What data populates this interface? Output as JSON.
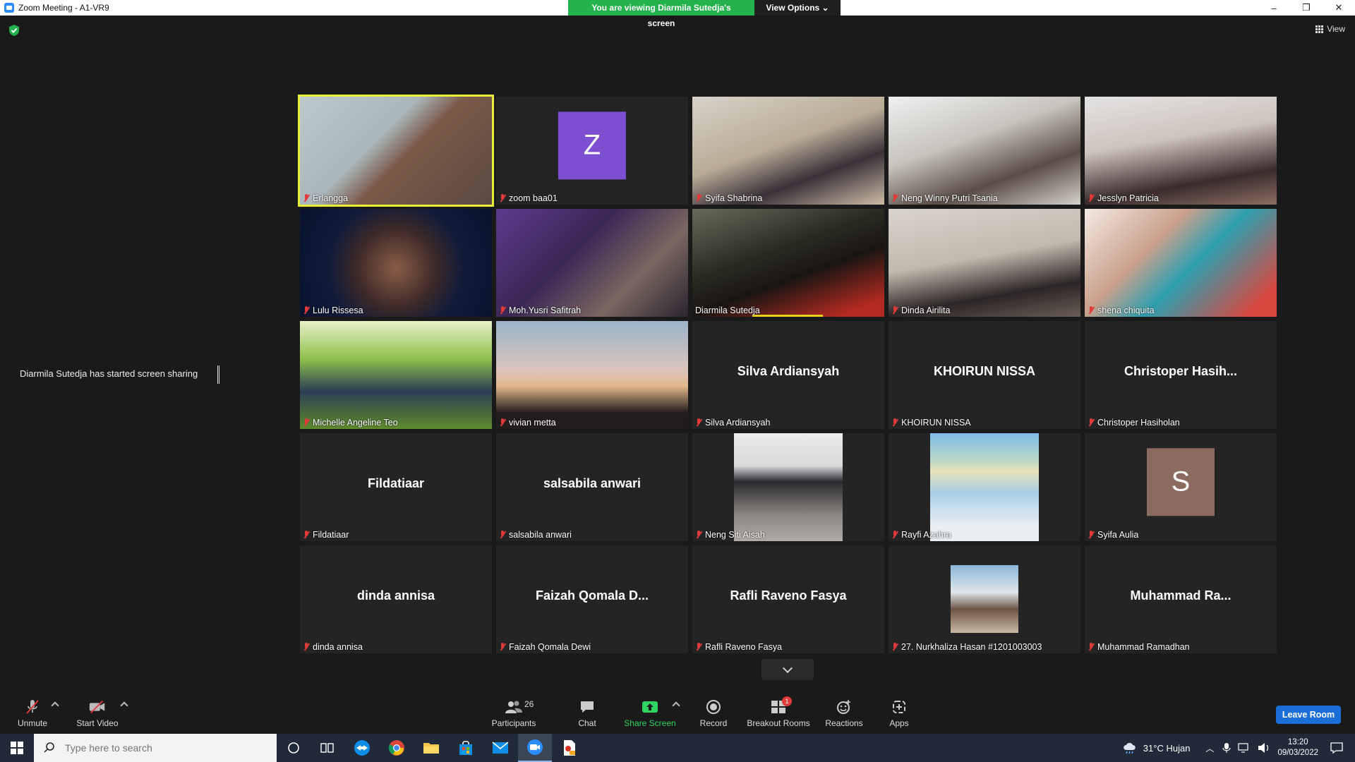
{
  "window": {
    "title": "Zoom Meeting - A1-VR9",
    "controls": [
      "–",
      "❐",
      "✕"
    ]
  },
  "banner": {
    "viewing": "You are viewing Diarmila Sutedja's screen",
    "view_options": "View Options ⌄"
  },
  "view_button": "View",
  "notice": "Diarmila Sutedja has started screen sharing",
  "tiles": [
    {
      "name": "Erlangga",
      "type": "video",
      "active": true,
      "bg": "linear-gradient(135deg,#bcc9cf 0%,#a9b6bb 40%,#7b5a48 55%,#5a4a42 100%)"
    },
    {
      "name": "zoom baa01",
      "type": "letter",
      "letter": "Z",
      "color": "#7b4fcf"
    },
    {
      "name": "Syifa Shabrina",
      "type": "video",
      "bg": "linear-gradient(160deg,#d8d2c8 0%,#b9ab97 45%,#3a3138 70%,#cdbba6 100%)"
    },
    {
      "name": "Neng Winny Putri Tsania",
      "type": "video",
      "bg": "linear-gradient(160deg,#eef0f0 0%,#c7c3bd 40%,#5b4c46 70%,#d6d2cc 100%)"
    },
    {
      "name": "Jesslyn Patricia",
      "type": "video",
      "bg": "linear-gradient(170deg,#e3e3e3 0%,#cfc3bd 40%,#3a2c2c 75%,#8b6f63 100%)"
    },
    {
      "name": "Lulu Rissesa",
      "type": "video",
      "bg": "radial-gradient(circle at 50% 55%,#8a5d47 0%,#3d2a28 35%,#101b3a 60%,#08122e 100%)"
    },
    {
      "name": "Moh.Yusri Safitrah",
      "type": "video",
      "bg": "linear-gradient(135deg,#5e3a8e 0%,#3b2755 40%,#7a6760 70%,#2b2430 100%)"
    },
    {
      "name": "Diarmila Sutedja",
      "type": "video",
      "speaking": true,
      "bg": "linear-gradient(160deg,#6a6a5a 0%,#2a2a22 40%,#1a1512 60%,#b22a20 90%)"
    },
    {
      "name": "Dinda Airilita",
      "type": "video",
      "bg": "linear-gradient(170deg,#d9d4cc 0%,#c3b9ad 45%,#2c2526 75%,#6a5d55 100%)"
    },
    {
      "name": "shena chiquita",
      "type": "video",
      "bg": "linear-gradient(135deg,#f3e9e2 0%,#c9a08b 35%,#2f9fb0 55%,#d8483e 90%)"
    },
    {
      "name": "Michelle Angeline Teo",
      "type": "video",
      "bg": "linear-gradient(180deg,#e8f1c8 0%,#8fc04d 35%,#2c3e56 65%,#5e8a2c 100%)"
    },
    {
      "name": "vivian metta",
      "type": "video",
      "bg": "linear-gradient(180deg,#9bb5c9 0%,#d9c4bc 45%,#e4b98b 60%,#231c1c 85%)"
    },
    {
      "name": "Silva Ardiansyah",
      "type": "name",
      "display": "Silva Ardiansyah"
    },
    {
      "name": "KHOIRUN NISSA",
      "type": "name",
      "display": "KHOIRUN NISSA"
    },
    {
      "name": "Christoper Hasiholan",
      "type": "name",
      "display": "Christoper  Hasih..."
    },
    {
      "name": "Fildatiaar",
      "type": "name",
      "display": "Fildatiaar"
    },
    {
      "name": "salsabila anwari",
      "type": "name",
      "display": "salsabila anwari"
    },
    {
      "name": "Neng Siti Aisah",
      "type": "pic",
      "bg": "linear-gradient(180deg,#e9eaec 0%,#d8dadc 30%,#2a2a2e 45%,#8a8580 75%,#b1aca6 100%)"
    },
    {
      "name": "Rayfi Azahra",
      "type": "pic",
      "bg": "linear-gradient(180deg,#7fbce6 0%,#b9d7c9 25%,#e8e3b7 35%,#a7cde6 55%,#e8eef2 85%)"
    },
    {
      "name": "Syifa Aulia",
      "type": "letter",
      "letter": "S",
      "color": "#8b6b60"
    },
    {
      "name": "dinda annisa",
      "type": "name",
      "display": "dinda annisa"
    },
    {
      "name": "Faizah Qomala Dewi",
      "type": "name",
      "display": "Faizah Qomala D..."
    },
    {
      "name": "Rafli Raveno Fasya",
      "type": "name",
      "display": "Rafli Raveno Fasya"
    },
    {
      "name": "27. Nurkhaliza Hasan #1201003003",
      "type": "pic-small",
      "bg": "linear-gradient(180deg,#8bb6d8 0%,#dfe6ea 40%,#6c5546 65%,#c9b9a6 100%)"
    },
    {
      "name": "Muhammad Ramadhan",
      "type": "name",
      "display": "Muhammad  Ra..."
    }
  ],
  "toolbar": {
    "unmute": "Unmute",
    "start_video": "Start Video",
    "participants": "Participants",
    "participants_count": "26",
    "chat": "Chat",
    "share_screen": "Share Screen",
    "record": "Record",
    "breakout_rooms": "Breakout Rooms",
    "breakout_badge": "1",
    "reactions": "Reactions",
    "apps": "Apps",
    "leave": "Leave Room"
  },
  "taskbar": {
    "search_placeholder": "Type here to search",
    "weather": "31°C  Hujan",
    "time": "13:20",
    "date": "09/03/2022"
  },
  "colors": {
    "accent_green": "#23b24b",
    "leave_blue": "#1a6ed8",
    "active_outline": "#e8ee3a",
    "muted_red": "#e03a3a"
  }
}
